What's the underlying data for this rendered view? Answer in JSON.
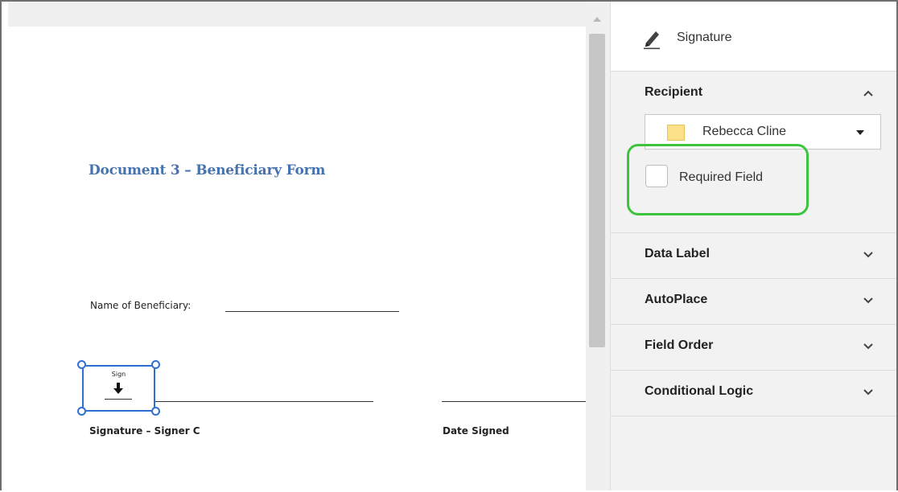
{
  "document": {
    "title": "Document 3 – Beneficiary Form",
    "name_label": "Name of Beneficiary:",
    "signature_label": "Signature – Signer C",
    "date_label": "Date Signed",
    "sign_field": {
      "text": "Sign",
      "icon": "download-arrow-icon"
    }
  },
  "panel": {
    "title": "Signature",
    "title_icon": "pen-icon",
    "recipient": {
      "label": "Recipient",
      "selected": "Rebecca Cline",
      "swatch_color": "#fde08a",
      "required_label": "Required Field",
      "required_checked": false,
      "highlight_color": "#3cc43c"
    },
    "sections": [
      {
        "label": "Data Label"
      },
      {
        "label": "AutoPlace"
      },
      {
        "label": "Field Order"
      },
      {
        "label": "Conditional Logic"
      }
    ]
  },
  "colors": {
    "selection_blue": "#2f6fd3",
    "title_blue": "#4673b0",
    "panel_bg": "#f2f2f2"
  }
}
